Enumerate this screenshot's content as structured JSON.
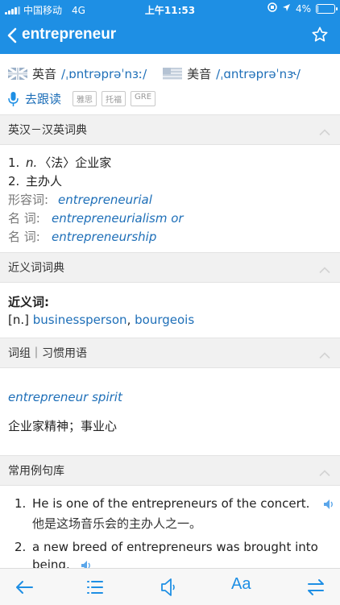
{
  "status_bar": {
    "carrier": "中国移动",
    "network": "4G",
    "time": "上午11:53",
    "battery": "4%",
    "battery_level": 0.04
  },
  "nav": {
    "title": "entrepreneur"
  },
  "pronunciation": {
    "uk_label": "英音",
    "uk_phonetic": "/ˌɒntrəprəˈnɜː/",
    "us_label": "美音",
    "us_phonetic": "/ˌɑntrəprəˈnɝ/"
  },
  "follow": {
    "label": "去跟读",
    "tags": [
      "雅思",
      "托福",
      "GRE"
    ]
  },
  "sections": {
    "dict": "英汉－汉英词典",
    "synonym": "近义词词典",
    "phrase": "词组｜习惯用语",
    "examples": "常用例句库"
  },
  "dict": {
    "defs": [
      {
        "num": "1.",
        "pos": "n.",
        "text": "〈法〉企业家"
      },
      {
        "num": "2.",
        "pos": "",
        "text": "主办人"
      }
    ],
    "forms": [
      {
        "label": "形容词:",
        "value": "entrepreneurial"
      },
      {
        "label": "名 词:",
        "value": "entrepreneurialism or"
      },
      {
        "label": "名 词:",
        "value": "entrepreneurship"
      }
    ]
  },
  "synonym": {
    "heading": "近义词:",
    "pos": "[n.]",
    "word1": "businessperson",
    "comma": ",",
    "word2": "bourgeois"
  },
  "phrase": {
    "en": "entrepreneur spirit",
    "zh": "企业家精神；事业心"
  },
  "examples": [
    {
      "num": "1.",
      "en": "He is one of the entrepreneurs of the concert.",
      "zh": "他是这场音乐会的主办人之一。"
    },
    {
      "num": "2.",
      "en_line1": "a new breed of entrepreneurs was brought into",
      "en_line2": "being."
    }
  ],
  "toolbar": {
    "font_label": "Aa"
  },
  "colors": {
    "brand": "#1e8fe4",
    "link": "#1e6fb8"
  }
}
